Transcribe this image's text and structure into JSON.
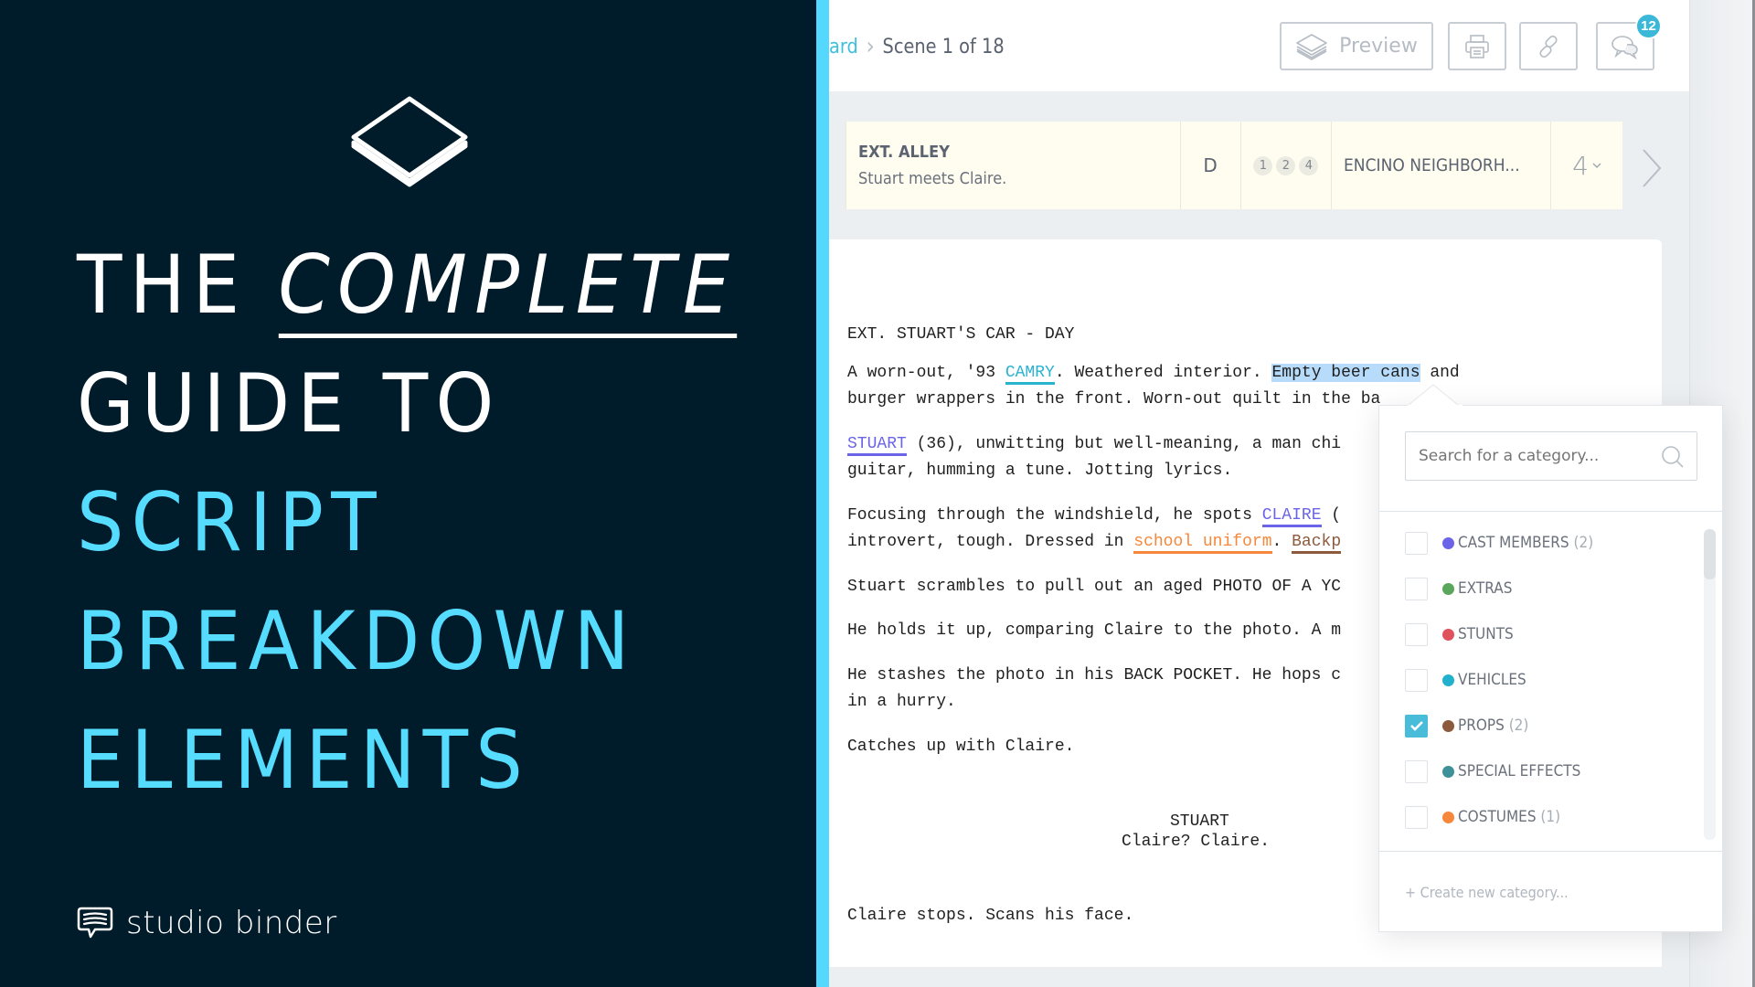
{
  "hero": {
    "line1_prefix": "THE ",
    "line1_emphasis": "COMPLETE",
    "line2": "GUIDE TO",
    "line3": "SCRIPT",
    "line4": "BREAKDOWN",
    "line5": "ELEMENTS",
    "brand": "studio binder",
    "colors": {
      "background": "#001b29",
      "accent": "#55dcff",
      "white": "#ffffff"
    }
  },
  "header": {
    "breadcrumb_link": "ard",
    "breadcrumb_current": "Scene 1 of 18",
    "preview_label": "Preview",
    "comment_count": "12"
  },
  "scene": {
    "heading": "EXT. ALLEY",
    "description": "Stuart meets Claire.",
    "day_night": "D",
    "cast_ids": [
      "1",
      "2",
      "4"
    ],
    "location": "ENCINO NEIGHBORH...",
    "pages": "4"
  },
  "script": {
    "slugline": "EXT. STUART'S CAR - DAY",
    "p1_a": "A worn-out, '93 ",
    "p1_vehicle": "CAMRY",
    "p1_b": ". Weathered interior. ",
    "p1_selected": "Empty beer cans",
    "p1_c": " and",
    "p1_line2": "burger wrappers in the front. Worn-out quilt in the ba",
    "p2_cast": "STUART",
    "p2_a": " (36), unwitting but well-meaning, a man chi",
    "p2_line2": "guitar, humming a tune. Jotting lyrics.",
    "p3_a": "Focusing through the windshield, he spots ",
    "p3_cast": "CLAIRE",
    "p3_b": " (",
    "p3_line2_a": "introvert, tough. Dressed in ",
    "p3_costume": "school uniform",
    "p3_line2_b": ". ",
    "p3_prop": "Backp",
    "p4": "Stuart scrambles to pull out an aged PHOTO OF A YC",
    "p5": "He holds it up, comparing Claire to the photo. A m",
    "p6_line1": "He stashes the photo in his BACK POCKET. He hops c",
    "p6_line2": "in a hurry.",
    "p7": "Catches up with Claire.",
    "dialogue_character": "STUART",
    "dialogue_line": "Claire? Claire.",
    "p8": "Claire stops. Scans his face."
  },
  "category_popup": {
    "search_placeholder": "Search for a category...",
    "categories": [
      {
        "label": "CAST MEMBERS",
        "count": "(2)",
        "color": "#6b64e8",
        "checked": false
      },
      {
        "label": "EXTRAS",
        "count": "",
        "color": "#5aa65a",
        "checked": false
      },
      {
        "label": "STUNTS",
        "count": "",
        "color": "#e0525c",
        "checked": false
      },
      {
        "label": "VEHICLES",
        "count": "",
        "color": "#22b1cc",
        "checked": false
      },
      {
        "label": "PROPS",
        "count": "(2)",
        "color": "#8c5a3c",
        "checked": true
      },
      {
        "label": "SPECIAL EFFECTS",
        "count": "",
        "color": "#3f9199",
        "checked": false
      },
      {
        "label": "COSTUMES",
        "count": "(1)",
        "color": "#f7873a",
        "checked": false
      }
    ],
    "create_label": "+ Create new category..."
  }
}
